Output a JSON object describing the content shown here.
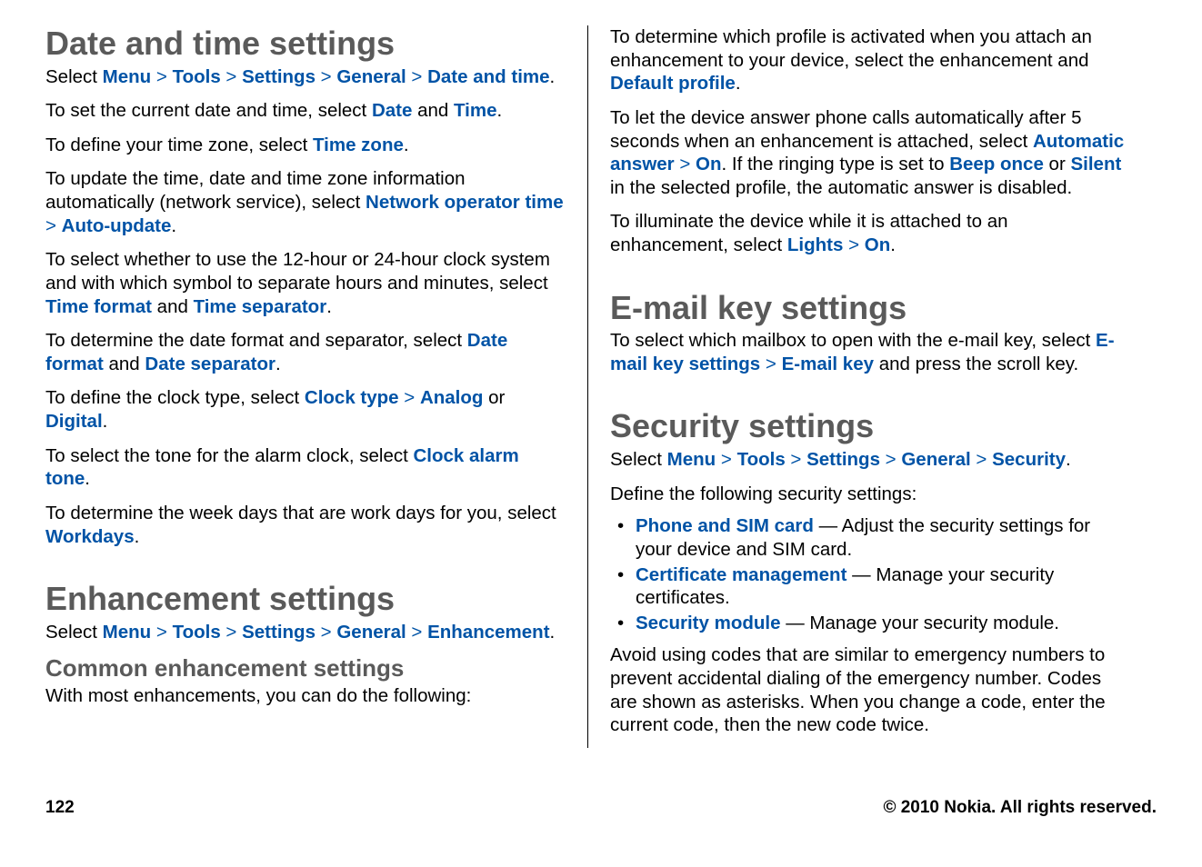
{
  "left": {
    "h1_datetime": "Date and time settings",
    "p1_pre": "Select ",
    "menu": "Menu",
    "gt": " > ",
    "tools": "Tools",
    "settings": "Settings",
    "general": "General",
    "dateandtime": "Date and time",
    "period": ".",
    "p2_pre": "To set the current date and time, select ",
    "date": "Date",
    "and": " and ",
    "time": "Time",
    "p3_pre": "To define your time zone, select ",
    "timezone": "Time zone",
    "p4_pre": "To update the time, date and time zone information automatically (network service), select ",
    "netoptime": "Network operator time",
    "autoupdate": "Auto-update",
    "p5_pre": "To select whether to use the 12-hour or 24-hour clock system and with which symbol to separate hours and minutes, select ",
    "timeformat": "Time format",
    "timesep": "Time separator",
    "p6_pre": "To determine the date format and separator, select ",
    "dateformat": "Date format",
    "datesep": "Date separator",
    "p7_pre": "To define the clock type, select ",
    "clocktype": "Clock type",
    "analog": "Analog",
    "or": " or ",
    "digital": "Digital",
    "p8_pre": "To select the tone for the alarm clock, select ",
    "clockalarmtone": "Clock alarm tone",
    "p9_pre": "To determine the week days that are work days for you, select ",
    "workdays": "Workdays",
    "h1_enh": "Enhancement settings",
    "enh": "Enhancement",
    "h2_common": "Common enhancement settings",
    "p_common": "With most enhancements, you can do the following:"
  },
  "right": {
    "p1_pre": "To determine which profile is activated when you attach an enhancement to your device, select the enhancement and ",
    "defprofile": "Default profile",
    "p2_pre": "To let the device answer phone calls automatically after 5 seconds when an enhancement is attached, select ",
    "autoanswer": "Automatic answer",
    "on": "On",
    "p2_mid": ". If the ringing type is set to ",
    "beeponce": "Beep once",
    "or": " or ",
    "silent": "Silent",
    "p2_end": " in the selected profile, the automatic answer is disabled.",
    "p3_pre": "To illuminate the device while it is attached to an enhancement, select ",
    "lights": "Lights",
    "h1_email": "E-mail key settings",
    "p4_pre": "To select which mailbox to open with the e-mail key, select ",
    "emailkeysettings": "E-mail key settings",
    "emailkey": "E-mail key",
    "p4_end": " and press the scroll key.",
    "h1_sec": "Security settings",
    "security": "Security",
    "p_define": "Define the following security settings:",
    "li1_link": "Phone and SIM card",
    "li1_text": " — Adjust the security settings for your device and SIM card.",
    "li2_link": "Certificate management",
    "li2_text": " — Manage your security certificates.",
    "li3_link": "Security module",
    "li3_text": " — Manage your security module.",
    "p_avoid": "Avoid using codes that are similar to emergency numbers to prevent accidental dialing of the emergency number. Codes are shown as asterisks. When you change a code, enter the current code, then the new code twice."
  },
  "footer": {
    "page": "122",
    "copyright": "© 2010 Nokia. All rights reserved."
  }
}
